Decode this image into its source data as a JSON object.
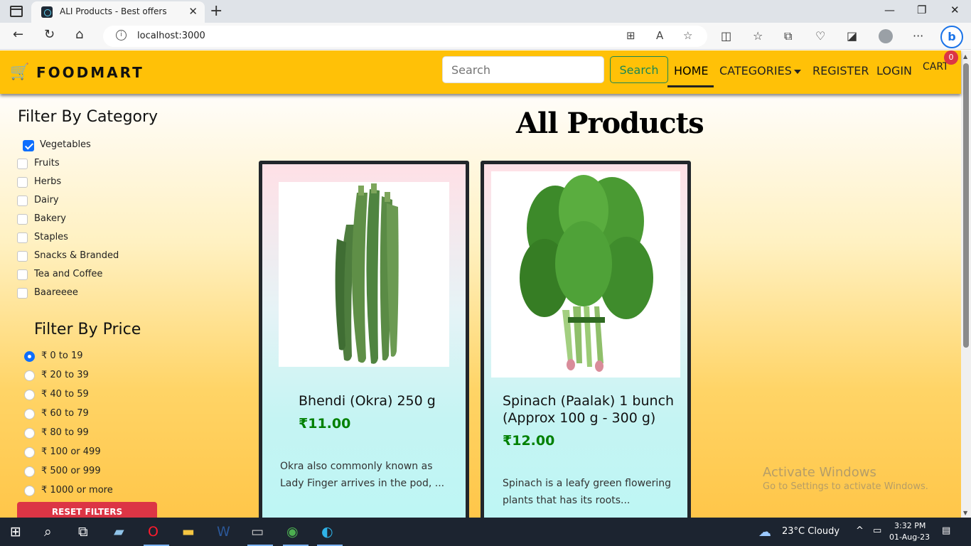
{
  "browser": {
    "tab_title": "ALI Products - Best offers",
    "url": "localhost:3000"
  },
  "site": {
    "brand": "FOODMART",
    "search_placeholder": "Search",
    "search_button": "Search",
    "nav": {
      "home": "HOME",
      "categories": "CATEGORIES",
      "register": "REGISTER",
      "login": "LOGIN",
      "cart": "CART",
      "cart_count": "0"
    }
  },
  "filters": {
    "category_title": "Filter By Category",
    "categories": [
      {
        "label": "Vegetables",
        "checked": true
      },
      {
        "label": "Fruits",
        "checked": false
      },
      {
        "label": "Herbs",
        "checked": false
      },
      {
        "label": "Dairy",
        "checked": false
      },
      {
        "label": "Bakery",
        "checked": false
      },
      {
        "label": "Staples",
        "checked": false
      },
      {
        "label": "Snacks & Branded",
        "checked": false
      },
      {
        "label": "Tea and Coffee",
        "checked": false
      },
      {
        "label": "Baareeee",
        "checked": false
      }
    ],
    "price_title": "Filter By Price",
    "prices": [
      {
        "label": "₹ 0 to 19",
        "checked": true
      },
      {
        "label": "₹ 20 to 39",
        "checked": false
      },
      {
        "label": "₹ 40 to 59",
        "checked": false
      },
      {
        "label": "₹ 60 to 79",
        "checked": false
      },
      {
        "label": "₹ 80 to 99",
        "checked": false
      },
      {
        "label": "₹ 100 or 499",
        "checked": false
      },
      {
        "label": "₹ 500 or 999",
        "checked": false
      },
      {
        "label": "₹ 1000 or more",
        "checked": false
      }
    ],
    "reset_button": "RESET FILTERS"
  },
  "products": {
    "title": "All Products",
    "items": [
      {
        "name": "Bhendi (Okra) 250 g",
        "price": "₹11.00",
        "description": "Okra also commonly known as Lady Finger arrives in the pod, ..."
      },
      {
        "name": "Spinach (Paalak) 1 bunch (Approx 100 g - 300 g)",
        "price": "₹12.00",
        "description": "Spinach is a leafy green flowering plants that has its roots..."
      }
    ]
  },
  "watermark": {
    "line1": "Activate Windows",
    "line2": "Go to Settings to activate Windows."
  },
  "taskbar": {
    "weather": "23°C  Cloudy",
    "time": "3:32 PM",
    "date": "01-Aug-23"
  }
}
